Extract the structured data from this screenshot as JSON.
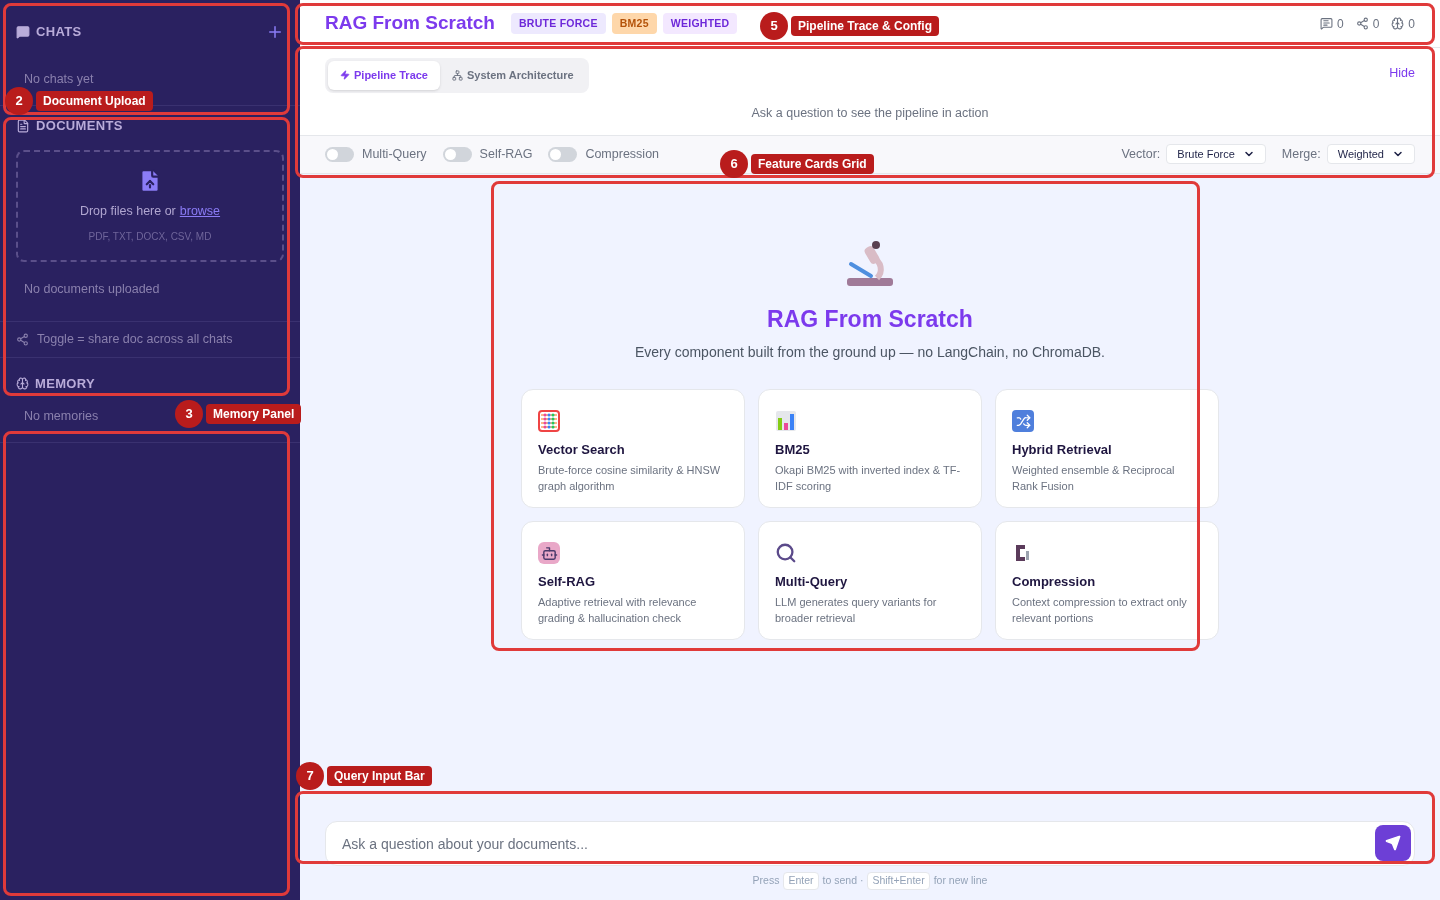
{
  "sidebar": {
    "chats": {
      "title": "CHATS",
      "empty": "No chats yet"
    },
    "documents": {
      "title": "DOCUMENTS",
      "drop_text": "Drop files here or",
      "browse_link": "browse",
      "formats": "PDF, TXT, DOCX, CSV, MD",
      "empty": "No documents uploaded",
      "share_hint": "Toggle = share doc across all chats"
    },
    "memory": {
      "title": "MEMORY",
      "empty": "No memories"
    }
  },
  "header": {
    "title": "RAG From Scratch",
    "badges": [
      {
        "label": "BRUTE FORCE",
        "color": "#ede9fe"
      },
      {
        "label": "BM25",
        "color": "#fed7aa"
      },
      {
        "label": "WEIGHTED",
        "color": "#f3e8ff"
      }
    ],
    "stats": [
      {
        "kind": "chats",
        "value": "0"
      },
      {
        "kind": "shared",
        "value": "0"
      },
      {
        "kind": "memories",
        "value": "0"
      }
    ]
  },
  "pipeline": {
    "tabs": [
      {
        "label": "Pipeline Trace",
        "selected": true
      },
      {
        "label": "System Architecture",
        "selected": false
      }
    ],
    "hide_link": "Hide",
    "empty": "Ask a question to see the pipeline in action",
    "toggles": [
      {
        "label": "Multi-Query",
        "on": false
      },
      {
        "label": "Self-RAG",
        "on": false
      },
      {
        "label": "Compression",
        "on": false
      }
    ],
    "selects": [
      {
        "label": "Vector:",
        "value": "Brute Force"
      },
      {
        "label": "Merge:",
        "value": "Weighted"
      }
    ]
  },
  "hero": {
    "title": "RAG From Scratch",
    "subtitle": "Every component built from the ground up — no LangChain, no ChromaDB."
  },
  "features": [
    {
      "kind": "abacus",
      "title": "Vector Search",
      "description": "Brute-force cosine similarity & HNSW graph algorithm"
    },
    {
      "kind": "chart",
      "title": "BM25",
      "description": "Okapi BM25 with inverted index & TF-IDF scoring"
    },
    {
      "kind": "shuffle",
      "title": "Hybrid Retrieval",
      "description": "Weighted ensemble & Reciprocal Rank Fusion"
    },
    {
      "kind": "robot",
      "title": "Self-RAG",
      "description": "Adaptive retrieval with relevance grading & hallucination check"
    },
    {
      "kind": "magnifier",
      "title": "Multi-Query",
      "description": "LLM generates query variants for broader retrieval"
    },
    {
      "kind": "clamp",
      "title": "Compression",
      "description": "Context compression to extract only relevant portions"
    }
  ],
  "query": {
    "placeholder": "Ask a question about your documents...",
    "hint": [
      "Press",
      "to send ·",
      "for new line"
    ],
    "keys": [
      "Enter",
      "Shift+Enter"
    ]
  },
  "annotations": [
    {
      "number": "2",
      "label": "Document Upload"
    },
    {
      "number": "3",
      "label": "Memory Panel"
    },
    {
      "number": "5",
      "label": "Pipeline Trace & Config"
    },
    {
      "number": "6",
      "label": "Feature Cards Grid"
    },
    {
      "number": "7",
      "label": "Query Input Bar"
    }
  ]
}
